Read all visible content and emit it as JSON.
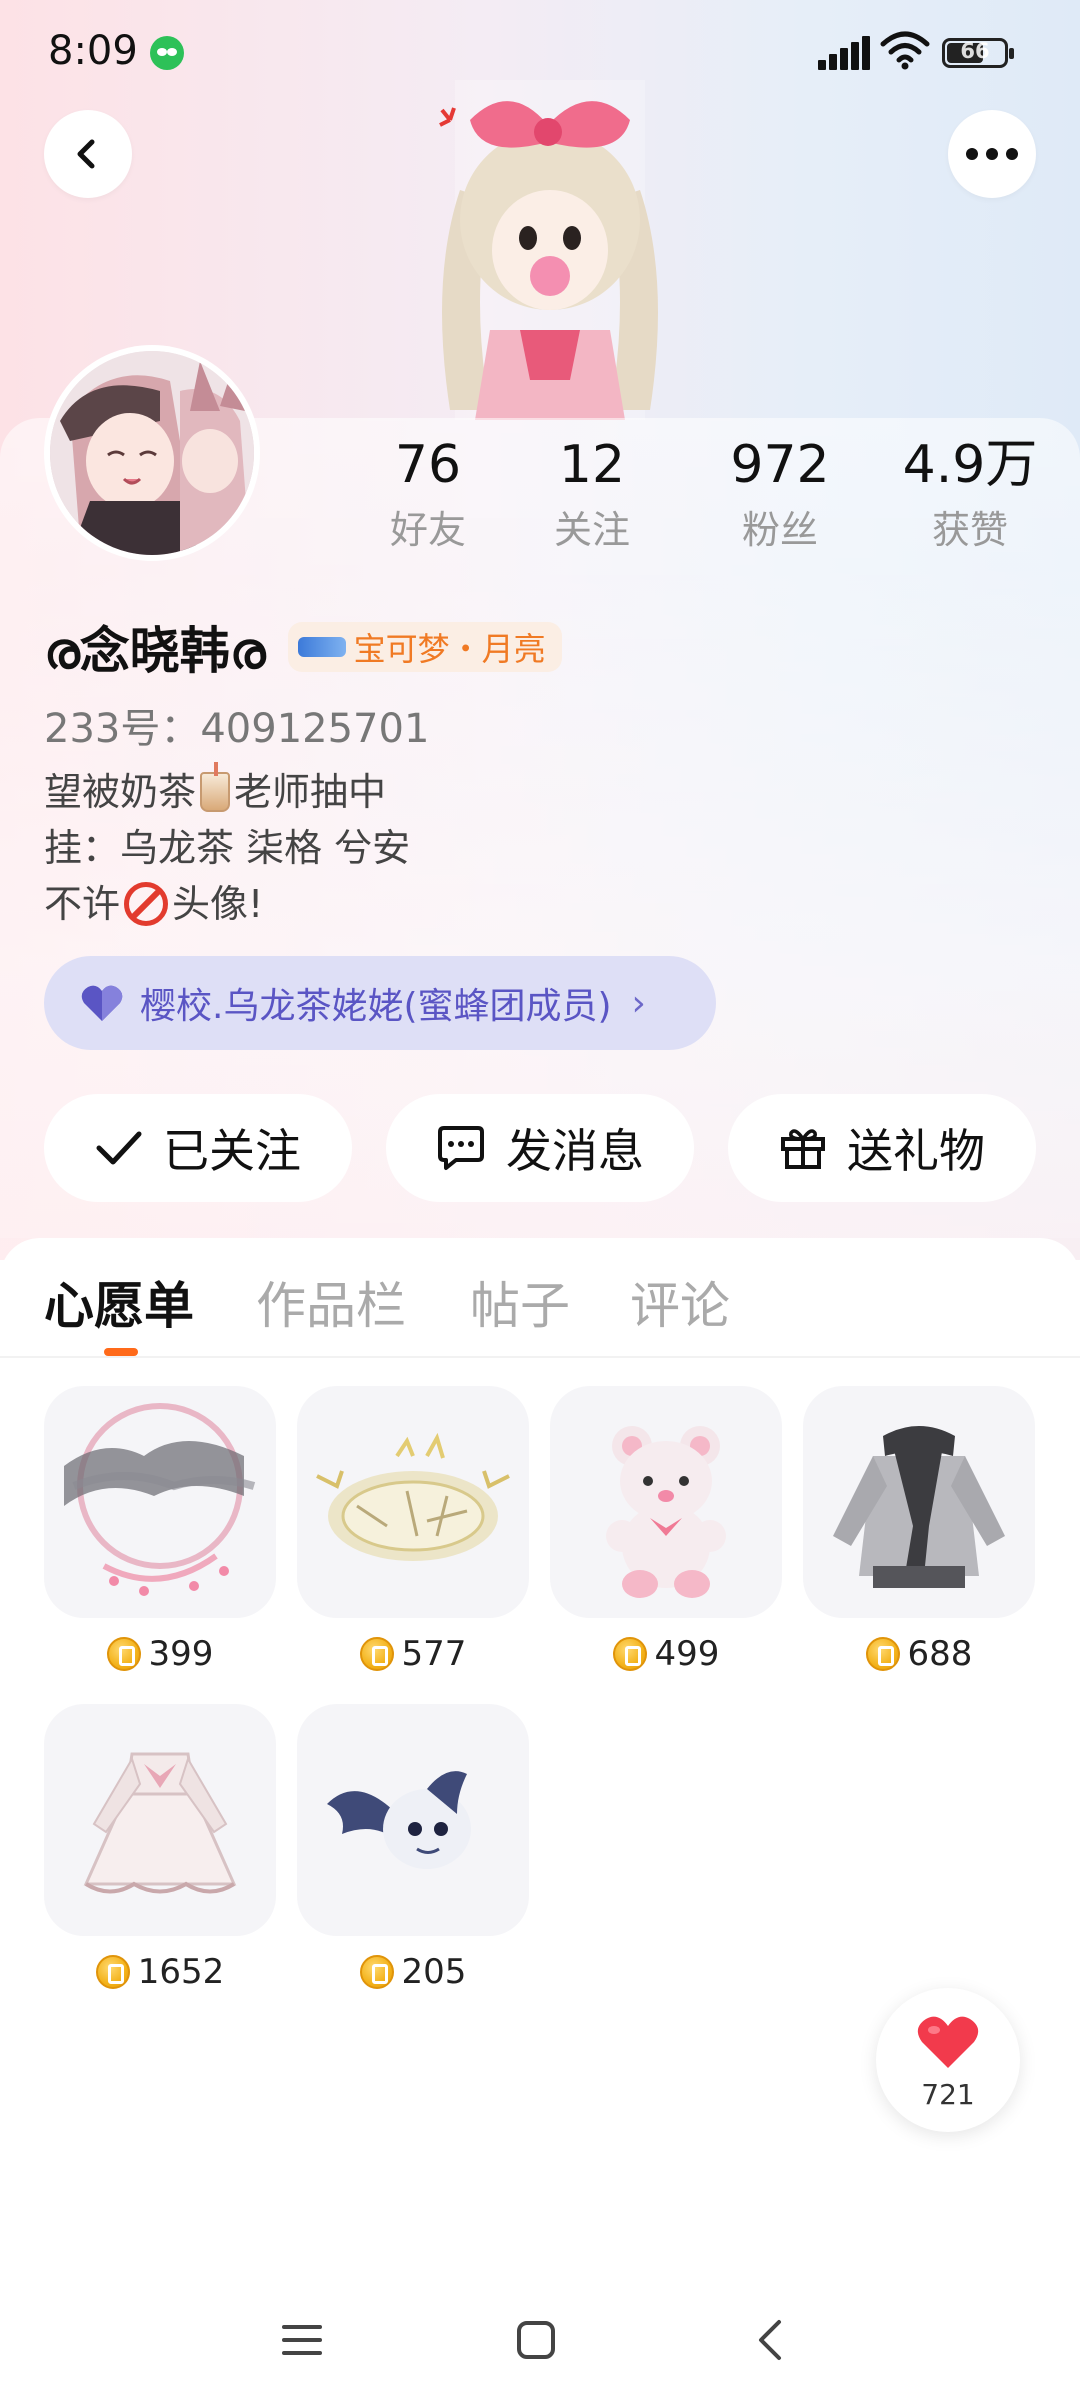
{
  "status_bar": {
    "time": "8:09",
    "battery": "66",
    "battery_level": 0.66
  },
  "header": {
    "back_icon": "chevron-left-icon",
    "more_icon": "more-dots-icon"
  },
  "profile": {
    "stats": [
      {
        "value": "76",
        "label": "好友"
      },
      {
        "value": "12",
        "label": "关注"
      },
      {
        "value": "972",
        "label": "粉丝"
      },
      {
        "value": "4.9万",
        "label": "获赞"
      }
    ],
    "username": "ര念晓韩ര",
    "game_badge": "宝可梦・月亮",
    "uid": "233号：409125701",
    "bio": {
      "line1_a": "望被奶茶",
      "line1_b": "老师抽中",
      "line2": "挂：乌龙茶 柒格 兮安",
      "line3_a": "不许",
      "line3_b": "头像!"
    },
    "guild": {
      "label": "樱校.乌龙茶姥姥(蜜蜂团成员)",
      "icon": "heart-icon"
    }
  },
  "actions": [
    {
      "label": "已关注",
      "icon": "check-icon"
    },
    {
      "label": "发消息",
      "icon": "chat-bubble-icon"
    },
    {
      "label": "送礼物",
      "icon": "gift-icon"
    }
  ],
  "tabs": [
    {
      "label": "心愿单",
      "active": true
    },
    {
      "label": "作品栏",
      "active": false
    },
    {
      "label": "帖子",
      "active": false
    },
    {
      "label": "评论",
      "active": false
    }
  ],
  "wishlist": [
    {
      "price": "399",
      "item": "ink-halo-accessory"
    },
    {
      "price": "577",
      "item": "golden-crown-accessory"
    },
    {
      "price": "499",
      "item": "pink-teddy-bear"
    },
    {
      "price": "688",
      "item": "grey-hoodie-outfit"
    },
    {
      "price": "1652",
      "item": "white-lolita-dress"
    },
    {
      "price": "205",
      "item": "bat-pet"
    }
  ],
  "like_button": {
    "count": "721"
  },
  "colors": {
    "accent_orange": "#ff6a1a",
    "coin_gold": "#f3b21a",
    "guild_purple": "#5a55c4",
    "like_red": "#f23a4c"
  }
}
